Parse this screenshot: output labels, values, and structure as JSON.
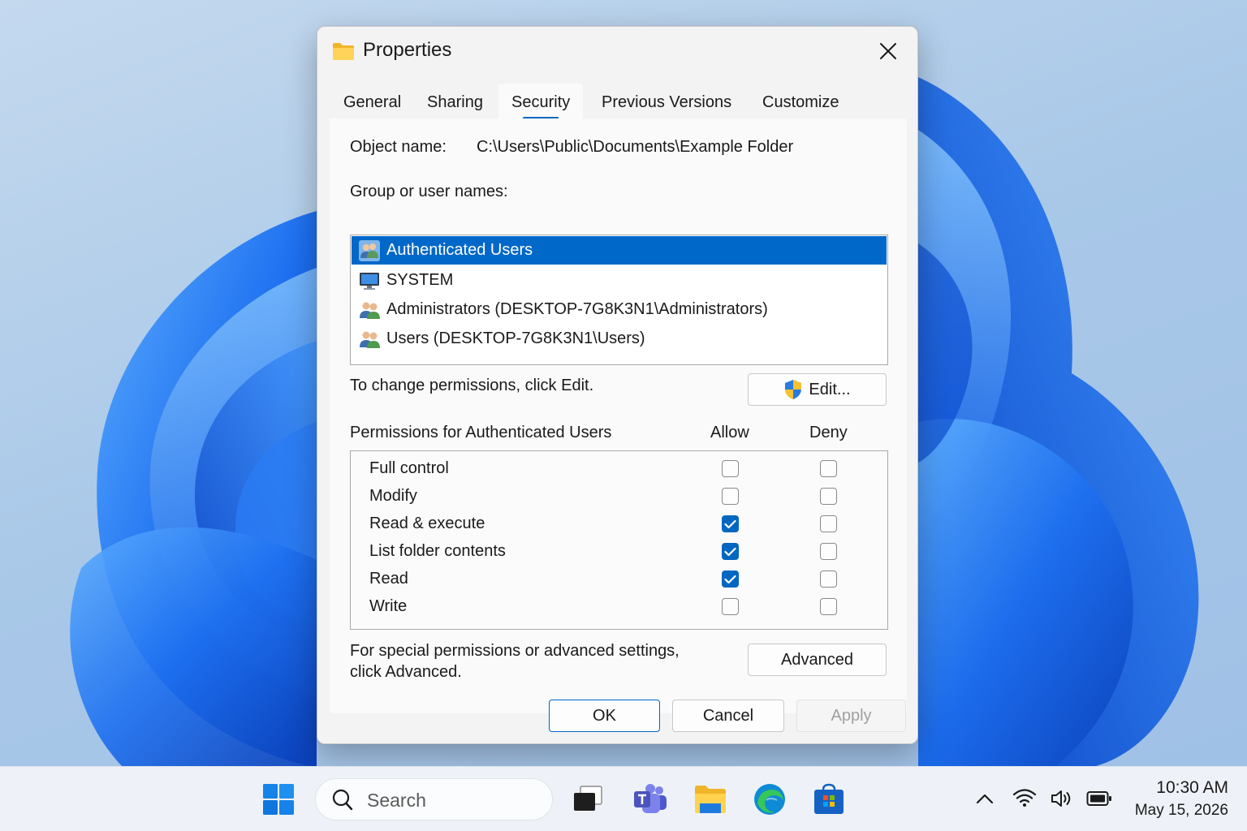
{
  "dialog": {
    "title": "Properties",
    "tabs": [
      {
        "label": "General",
        "active": false
      },
      {
        "label": "Sharing",
        "active": false
      },
      {
        "label": "Security",
        "active": true
      },
      {
        "label": "Previous Versions",
        "active": false
      },
      {
        "label": "Customize",
        "active": false
      }
    ],
    "object_name_label": "Object name:",
    "object_name_value": "C:\\Users\\Public\\Documents\\Example Folder",
    "group_label": "Group or user names:",
    "users": [
      {
        "name": "Authenticated Users",
        "icon": "users-group-icon",
        "selected": true
      },
      {
        "name": "SYSTEM",
        "icon": "computer-monitor-icon",
        "selected": false
      },
      {
        "name": "Administrators (DESKTOP-7G8K3N1\\Administrators)",
        "icon": "users-group-icon",
        "selected": false
      },
      {
        "name": "Users (DESKTOP-7G8K3N1\\Users)",
        "icon": "users-group-icon",
        "selected": false
      }
    ],
    "change_text": "To change permissions, click Edit.",
    "edit_button": "Edit...",
    "permissions_label": "Permissions for Authenticated Users",
    "allow_header": "Allow",
    "deny_header": "Deny",
    "permissions": [
      {
        "name": "Full control",
        "allow": false,
        "deny": false
      },
      {
        "name": "Modify",
        "allow": false,
        "deny": false
      },
      {
        "name": "Read & execute",
        "allow": true,
        "deny": false
      },
      {
        "name": "List folder contents",
        "allow": true,
        "deny": false
      },
      {
        "name": "Read",
        "allow": true,
        "deny": false
      },
      {
        "name": "Write",
        "allow": false,
        "deny": false
      }
    ],
    "advanced_text_1": "For special permissions or advanced settings,",
    "advanced_text_2": "click Advanced.",
    "advanced_button": "Advanced",
    "ok_button": "OK",
    "cancel_button": "Cancel",
    "apply_button": "Apply"
  },
  "taskbar": {
    "search_placeholder": "Search",
    "apps": [
      "windows-start-icon",
      "task-view-icon",
      "teams-icon",
      "file-explorer-icon",
      "edge-icon",
      "store-icon"
    ],
    "time": "10:30 AM",
    "date": "May 15, 2026"
  },
  "colors": {
    "accent": "#0067c0",
    "selection": "#0068c9",
    "wallpaper_bloom": "#1b63e0"
  }
}
